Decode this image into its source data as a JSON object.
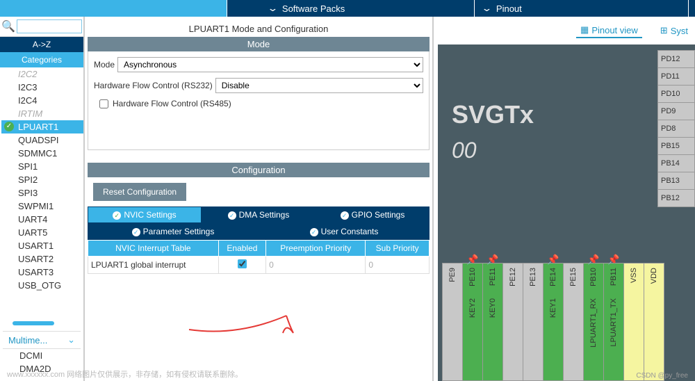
{
  "topbar": {
    "software_packs": "Software Packs",
    "pinout": "Pinout"
  },
  "sidebar": {
    "sort_label": "A->Z",
    "categories_label": "Categories",
    "items": [
      {
        "label": "I2C2",
        "dim": true,
        "sel": false
      },
      {
        "label": "I2C3",
        "dim": false,
        "sel": false
      },
      {
        "label": "I2C4",
        "dim": false,
        "sel": false
      },
      {
        "label": "IRTIM",
        "dim": true,
        "sel": false
      },
      {
        "label": "LPUART1",
        "dim": false,
        "sel": true
      },
      {
        "label": "QUADSPI",
        "dim": false,
        "sel": false
      },
      {
        "label": "SDMMC1",
        "dim": false,
        "sel": false
      },
      {
        "label": "SPI1",
        "dim": false,
        "sel": false
      },
      {
        "label": "SPI2",
        "dim": false,
        "sel": false
      },
      {
        "label": "SPI3",
        "dim": false,
        "sel": false
      },
      {
        "label": "SWPMI1",
        "dim": false,
        "sel": false
      },
      {
        "label": "UART4",
        "dim": false,
        "sel": false
      },
      {
        "label": "UART5",
        "dim": false,
        "sel": false
      },
      {
        "label": "USART1",
        "dim": false,
        "sel": false
      },
      {
        "label": "USART2",
        "dim": false,
        "sel": false
      },
      {
        "label": "USART3",
        "dim": false,
        "sel": false
      },
      {
        "label": "USB_OTG",
        "dim": false,
        "sel": false
      }
    ],
    "multimedia_label": "Multime...",
    "footer_items": [
      "DCMI",
      "DMA2D"
    ]
  },
  "center": {
    "title": "LPUART1 Mode and Configuration",
    "mode_header": "Mode",
    "mode_label": "Mode",
    "mode_value": "Asynchronous",
    "hwflow_label": "Hardware Flow Control (RS232)",
    "hwflow_value": "Disable",
    "rs485_label": "Hardware Flow Control (RS485)",
    "config_header": "Configuration",
    "reset_label": "Reset Configuration",
    "tabs1": [
      "NVIC Settings",
      "DMA Settings",
      "GPIO Settings"
    ],
    "tabs2": [
      "Parameter Settings",
      "User Constants"
    ],
    "nvic": {
      "col_interrupt": "NVIC Interrupt Table",
      "col_enabled": "Enabled",
      "col_preempt": "Preemption Priority",
      "col_sub": "Sub Priority",
      "row_name": "LPUART1 global interrupt",
      "row_preempt": "0",
      "row_sub": "0"
    }
  },
  "right": {
    "pinout_view": "Pinout view",
    "system_view": "Syst",
    "chip_part": "SVGTx",
    "chip_num": "00",
    "pins_right": [
      "PD12",
      "PD11",
      "PD10",
      "PD9",
      "PD8",
      "PB15",
      "PB14",
      "PB13",
      "PB12"
    ],
    "pins_bottom": [
      {
        "label": "PE9",
        "func": "",
        "green": false
      },
      {
        "label": "PE10",
        "func": "KEY2",
        "green": true,
        "thumb": true
      },
      {
        "label": "PE11",
        "func": "KEY0",
        "green": true,
        "thumb": true
      },
      {
        "label": "PE12",
        "func": "",
        "green": false
      },
      {
        "label": "PE13",
        "func": "",
        "green": false
      },
      {
        "label": "PE14",
        "func": "KEY1",
        "green": true,
        "thumb": true
      },
      {
        "label": "PE15",
        "func": "",
        "green": false
      },
      {
        "label": "PB10",
        "func": "LPUART1_RX",
        "green": true,
        "thumb": true
      },
      {
        "label": "PB11",
        "func": "LPUART1_TX",
        "green": true,
        "thumb": true
      },
      {
        "label": "VSS",
        "func": "",
        "green": false,
        "yellow": true
      },
      {
        "label": "VDD",
        "func": "",
        "green": false,
        "yellow": true
      }
    ]
  },
  "watermark": "www.xxxxxx.com  网络图片仅供展示，非存储，如有侵权请联系删除。",
  "copyright": "CSDN @py_free"
}
